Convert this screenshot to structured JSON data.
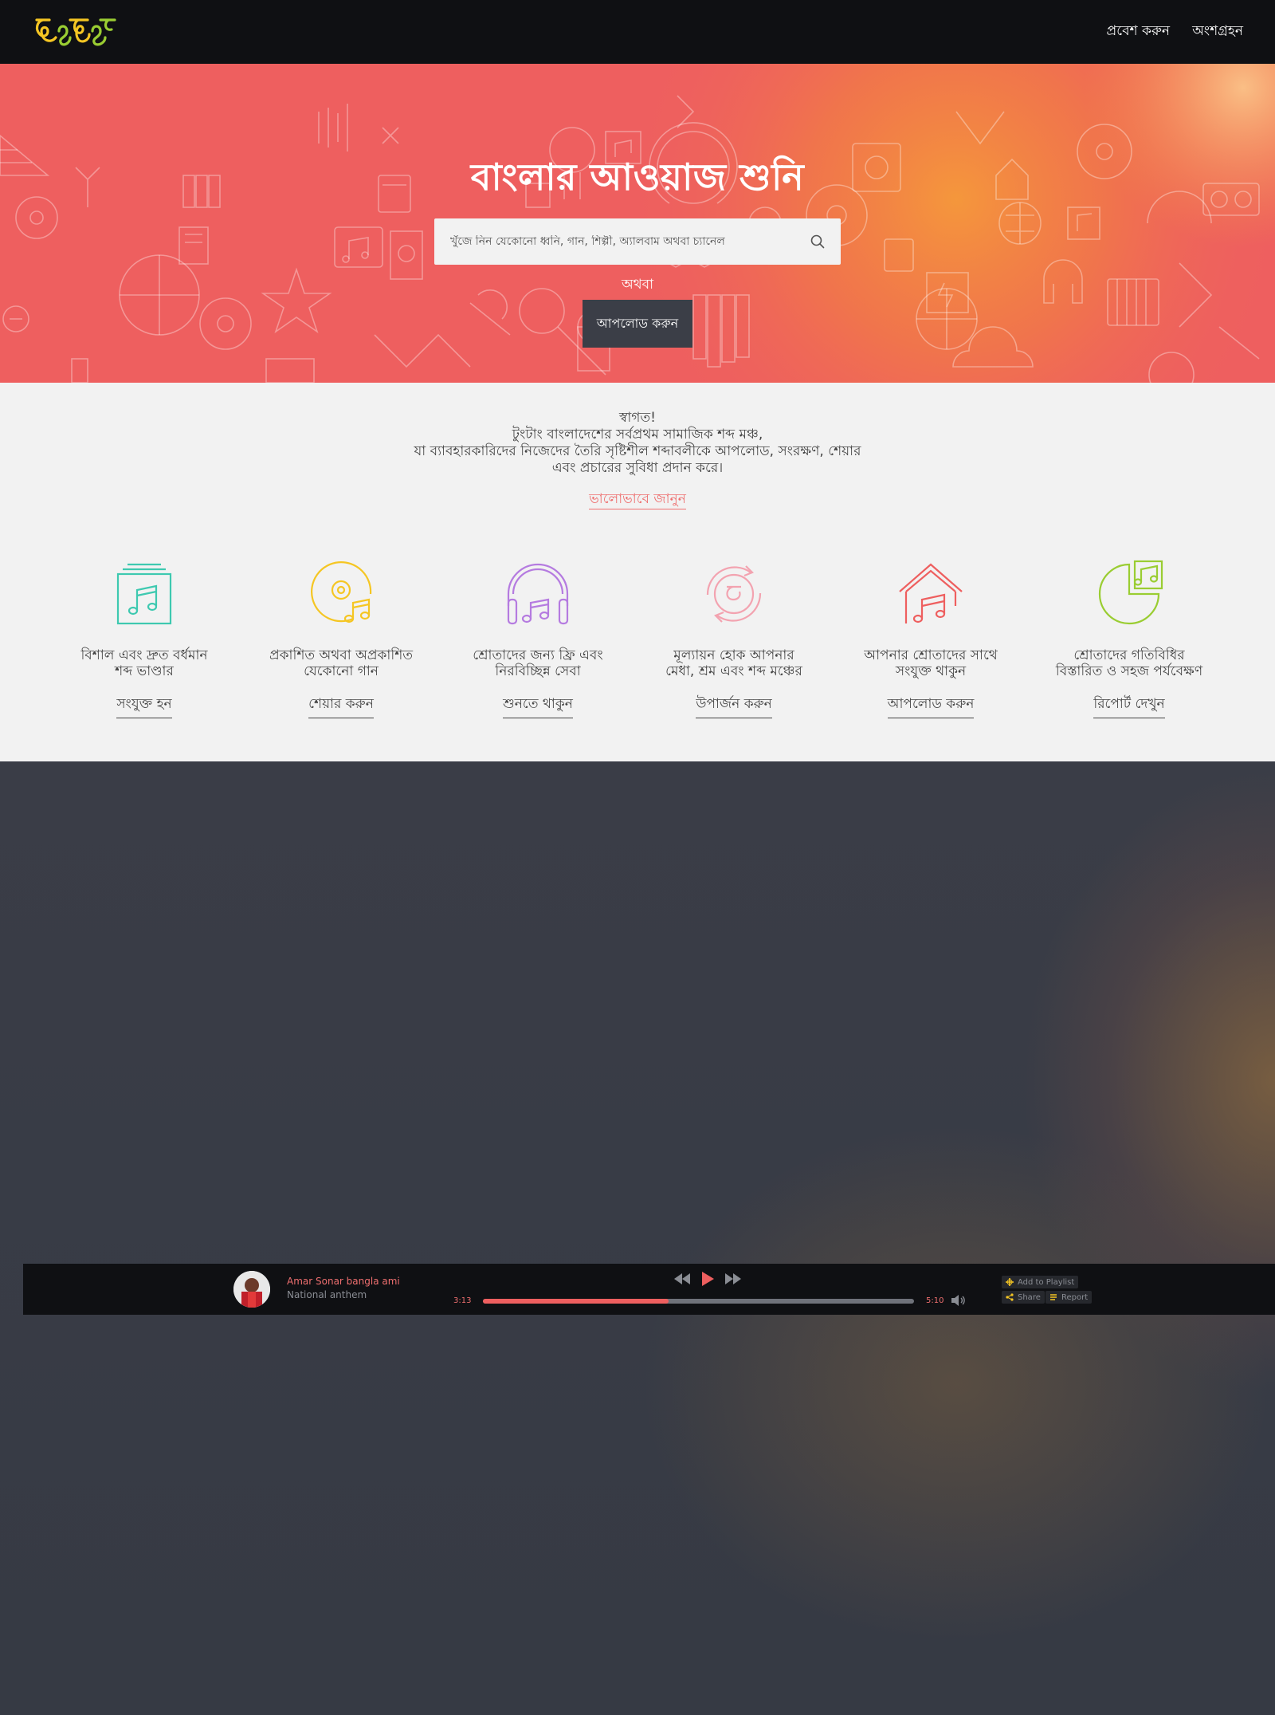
{
  "header": {
    "logo_text": "টুংটাং",
    "nav": [
      {
        "label": "প্রবেশ করুন"
      },
      {
        "label": "অংশগ্রহন"
      }
    ]
  },
  "hero": {
    "title": "বাংলার আওয়াজ শুনি",
    "search_placeholder": "খুঁজে নিন যেকোনো ধ্বনি, গান, শিল্পী, অ্যালবাম অথবা চ্যানেল",
    "or_text": "অথবা",
    "upload_label": "আপলোড করুন",
    "colors": {
      "base": "#ee5f5f",
      "glow": "#f59a3a"
    }
  },
  "intro": {
    "welcome_lines": [
      "স্বাগত!",
      "টুংটাং বাংলাদেশের সর্বপ্রথম সামাজিক শব্দ মঞ্চ,",
      "যা ব্যাবহারকারিদের নিজেদের  তৈরি সৃষ্টিশীল শব্দাবলীকে আপলোড, সংরক্ষণ, শেয়ার",
      "এবং প্রচারের সুবিধা প্রদান করে।"
    ],
    "learn_more": "ভালোভাবে জানুন"
  },
  "features": [
    {
      "icon": "music-album-icon",
      "color": "#3ec9b0",
      "line1": "বিশাল এবং দ্রুত বর্ধমান",
      "line2": "শব্দ ভাণ্ডার",
      "link": "সংযুক্ত হন"
    },
    {
      "icon": "music-disc-icon",
      "color": "#f5c623",
      "line1": "প্রকাশিত অথবা অপ্রকাশিত",
      "line2": "যেকোনো গান",
      "link": "শেয়ার করুন"
    },
    {
      "icon": "headphones-icon",
      "color": "#b57be0",
      "line1": "শ্রোতাদের জন্য ফ্রি এবং",
      "line2": "নিরবিচ্ছিন্ন সেবা",
      "link": "শুনতে থাকুন"
    },
    {
      "icon": "taka-coin-icon",
      "color": "#f3a3b0",
      "line1": "মূল্যায়ন হোক আপনার",
      "line2": "মেধা, শ্রম এবং শব্দ মঞ্চের",
      "link": "উপার্জন করুন"
    },
    {
      "icon": "music-house-icon",
      "color": "#ee5f5f",
      "line1": "আপনার শ্রোতাদের সাথে",
      "line2": "সংযুক্ত থাকুন",
      "link": "আপলোড করুন"
    },
    {
      "icon": "music-pie-chart-icon",
      "color": "#9acd32",
      "line1": "শ্রোতাদের গতিবিধির",
      "line2": "বিস্তারিত ও সহজ পর্যবেক্ষণ",
      "link": "রিপোর্ট দেখুন"
    }
  ],
  "player": {
    "title": "Amar Sonar bangla ami",
    "subtitle": "National anthem",
    "time_current": "3:13",
    "time_total": "5:10",
    "progress": 0.43,
    "add_to_playlist": "Add to Playlist",
    "share": "Share",
    "report": "Report",
    "accent": "#ee5f5f"
  }
}
